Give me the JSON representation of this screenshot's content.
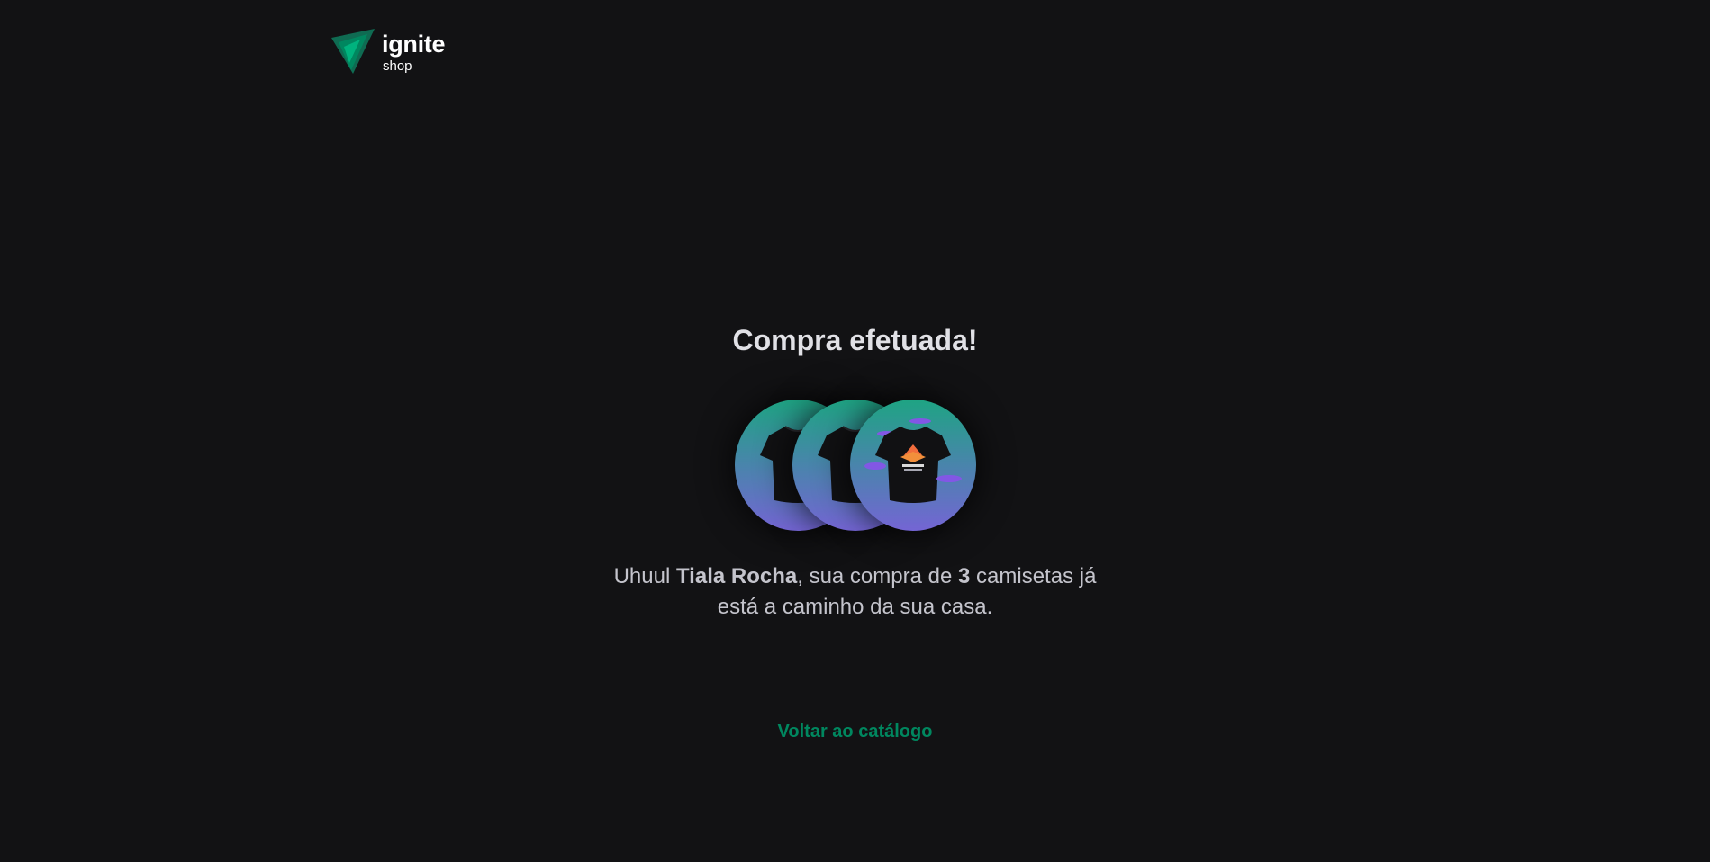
{
  "header": {
    "logo_icon": "ignite-logo-icon",
    "logo_title": "ignite",
    "logo_subtitle": "shop",
    "brand_color": "#00875f"
  },
  "success": {
    "title": "Compra efetuada!",
    "products": [
      {
        "icon": "tshirt-image"
      },
      {
        "icon": "tshirt-image"
      },
      {
        "icon": "tshirt-print-image"
      }
    ],
    "message": {
      "prefix": "Uhuul ",
      "customer_name": "Tiala Rocha",
      "middle": ", sua compra de ",
      "quantity": "3",
      "suffix": " camisetas já está a caminho da sua casa."
    },
    "back_link_label": "Voltar ao catálogo"
  },
  "colors": {
    "background": "#121214",
    "gradient_top": "#1ea483",
    "gradient_bottom": "#7465d4",
    "link": "#00875f"
  }
}
